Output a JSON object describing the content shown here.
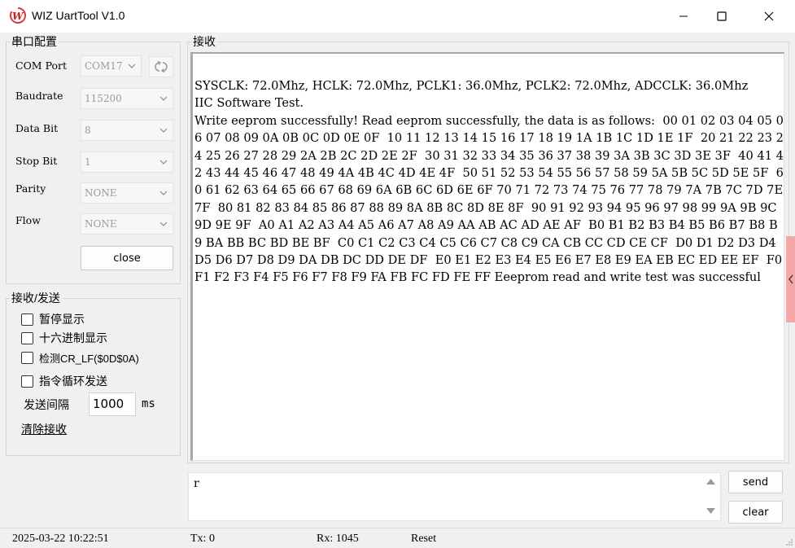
{
  "window": {
    "title": "WIZ UartTool V1.0",
    "logo_letter": "W"
  },
  "serial": {
    "group_title": "串口配置",
    "com_port": {
      "label": "COM Port",
      "value": "COM17"
    },
    "baudrate": {
      "label": "Baudrate",
      "value": "115200"
    },
    "data_bit": {
      "label": "Data Bit",
      "value": "8"
    },
    "stop_bit": {
      "label": "Stop Bit",
      "value": "1"
    },
    "parity": {
      "label": "Parity",
      "value": "NONE"
    },
    "flow": {
      "label": "Flow",
      "value": "NONE"
    },
    "close_label": "close"
  },
  "receive": {
    "group_title": "接收",
    "text": "SYSCLK: 72.0Mhz, HCLK: 72.0Mhz, PCLK1: 36.0Mhz, PCLK2: 72.0Mhz, ADCCLK: 36.0Mhz\nIIC Software Test.\nWrite eeprom successfully! Read eeprom successfully, the data is as follows:  00 01 02 03 04 05 06 07 08 09 0A 0B 0C 0D 0E 0F  10 11 12 13 14 15 16 17 18 19 1A 1B 1C 1D 1E 1F  20 21 22 23 24 25 26 27 28 29 2A 2B 2C 2D 2E 2F  30 31 32 33 34 35 36 37 38 39 3A 3B 3C 3D 3E 3F  40 41 42 43 44 45 46 47 48 49 4A 4B 4C 4D 4E 4F  50 51 52 53 54 55 56 57 58 59 5A 5B 5C 5D 5E 5F  60 61 62 63 64 65 66 67 68 69 6A 6B 6C 6D 6E 6F 70 71 72 73 74 75 76 77 78 79 7A 7B 7C 7D 7E 7F  80 81 82 83 84 85 86 87 88 89 8A 8B 8C 8D 8E 8F  90 91 92 93 94 95 96 97 98 99 9A 9B 9C 9D 9E 9F  A0 A1 A2 A3 A4 A5 A6 A7 A8 A9 AA AB AC AD AE AF  B0 B1 B2 B3 B4 B5 B6 B7 B8 B9 BA BB BC BD BE BF  C0 C1 C2 C3 C4 C5 C6 C7 C8 C9 CA CB CC CD CE CF  D0 D1 D2 D3 D4 D5 D6 D7 D8 D9 DA DB DC DD DE DF  E0 E1 E2 E3 E4 E5 E6 E7 E8 E9 EA EB EC ED EE EF  F0 F1 F2 F3 F4 F5 F6 F7 F8 F9 FA FB FC FD FE FF Eeeprom read and write test was successful"
  },
  "options": {
    "group_title": "接收/发送",
    "pause_display": "暂停显示",
    "hex_display": "十六进制显示",
    "detect_crlf": "检测CR_LF($0D$0A)",
    "loop_send": "指令循环发送",
    "interval_label": "发送间隔",
    "interval_value": "1000",
    "interval_unit": "ms",
    "clear_receive": "清除接收"
  },
  "send": {
    "text": "r",
    "send_label": "send",
    "clear_label": "clear"
  },
  "status": {
    "datetime": "2025-03-22 10:22:51",
    "tx": "Tx: 0",
    "rx": "Rx: 1045",
    "reset": "Reset"
  }
}
